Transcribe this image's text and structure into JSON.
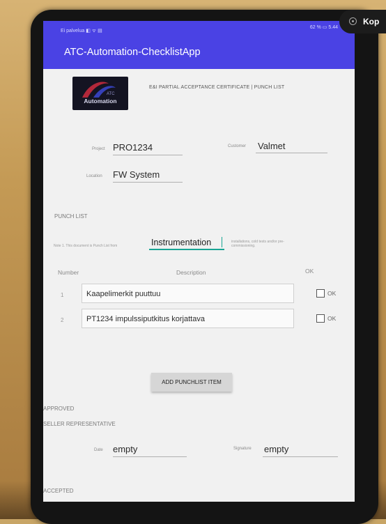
{
  "status_bar": {
    "left": "Ei palvelua ◧ ᯤ ▤",
    "right": "62 % ▭ 5.44"
  },
  "app": {
    "title": "ATC-Automation-ChecklistApp"
  },
  "logo": {
    "text": "Automation"
  },
  "certificate_title": "E&I PARTIAL ACCEPTANCE CERTIFICATE | PUNCH LIST",
  "fields": {
    "project_label": "Project",
    "project_value": "PRO1234",
    "customer_label": "Customer",
    "customer_value": "Valmet",
    "location_label": "Location",
    "location_value": "FW System"
  },
  "punch_list": {
    "heading": "PUNCH LIST",
    "note_left": "Note 1. This document is Punch List from",
    "note_input": "Instrumentation",
    "note_right": "installations, cold tests and/or pre-commissioning.",
    "headers": {
      "number": "Number",
      "description": "Description",
      "ok": "OK"
    },
    "rows": [
      {
        "number": "1",
        "description": "Kaapelimerkit puuttuu",
        "ok_label": "OK",
        "checked": false
      },
      {
        "number": "2",
        "description": "PT1234 impulssiputkitus korjattava",
        "ok_label": "OK",
        "checked": false
      }
    ],
    "add_button": "ADD PUNCHLIST ITEM"
  },
  "approval": {
    "approved": "APPROVED",
    "seller_rep": "SELLER REPRESENTATIVE",
    "date_label": "Date",
    "date_value": "empty",
    "signature_label": "Signature",
    "signature_value": "empty",
    "accepted": "ACCEPTED"
  },
  "overlay": {
    "label": "Kop"
  },
  "colors": {
    "appbar": "#4a42e4",
    "accent": "#18a594"
  }
}
